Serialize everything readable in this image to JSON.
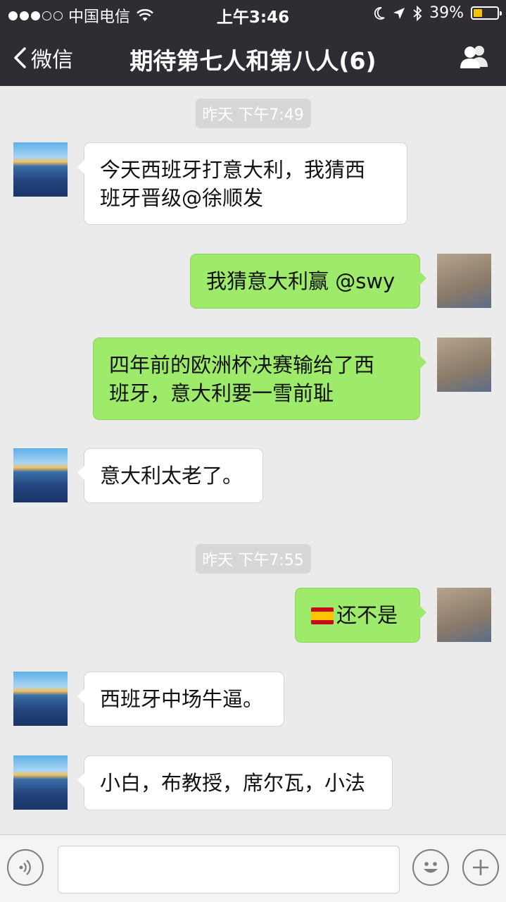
{
  "status_bar": {
    "carrier": "中国电信",
    "time": "上午3:46",
    "battery_text": "39%",
    "battery_level": 0.39
  },
  "nav": {
    "back_label": "微信",
    "title": "期待第七人和第八人(6)"
  },
  "timestamps": [
    "昨天 下午7:49",
    "昨天 下午7:55"
  ],
  "messages": [
    {
      "side": "in",
      "line1": "今天西班牙打意大利，我猜西",
      "line2": "班牙晋级@徐顺发"
    },
    {
      "side": "out",
      "line1": "我猜意大利赢 @swy"
    },
    {
      "side": "out",
      "line1": "四年前的欧洲杯决赛输给了西",
      "line2": "班牙，意大利要一雪前耻"
    },
    {
      "side": "in",
      "line1": "意大利太老了。"
    },
    {
      "side": "out",
      "flag": "spain-flag-icon",
      "line1": "还不是"
    },
    {
      "side": "in",
      "line1": "西班牙中场牛逼。"
    },
    {
      "side": "in",
      "line1": "小白，布教授，席尔瓦，小法"
    }
  ],
  "input": {
    "placeholder": ""
  },
  "icons": {
    "voice": "voice-icon",
    "emoji": "emoji-icon",
    "plus": "plus-icon",
    "group": "group-members-icon",
    "back": "chevron-left-icon"
  },
  "colors": {
    "header_bg": "#2f2d33",
    "chat_bg": "#ebebeb",
    "outgoing_bubble": "#9eea6a",
    "incoming_bubble": "#ffffff",
    "battery_fill": "#f5c400"
  }
}
